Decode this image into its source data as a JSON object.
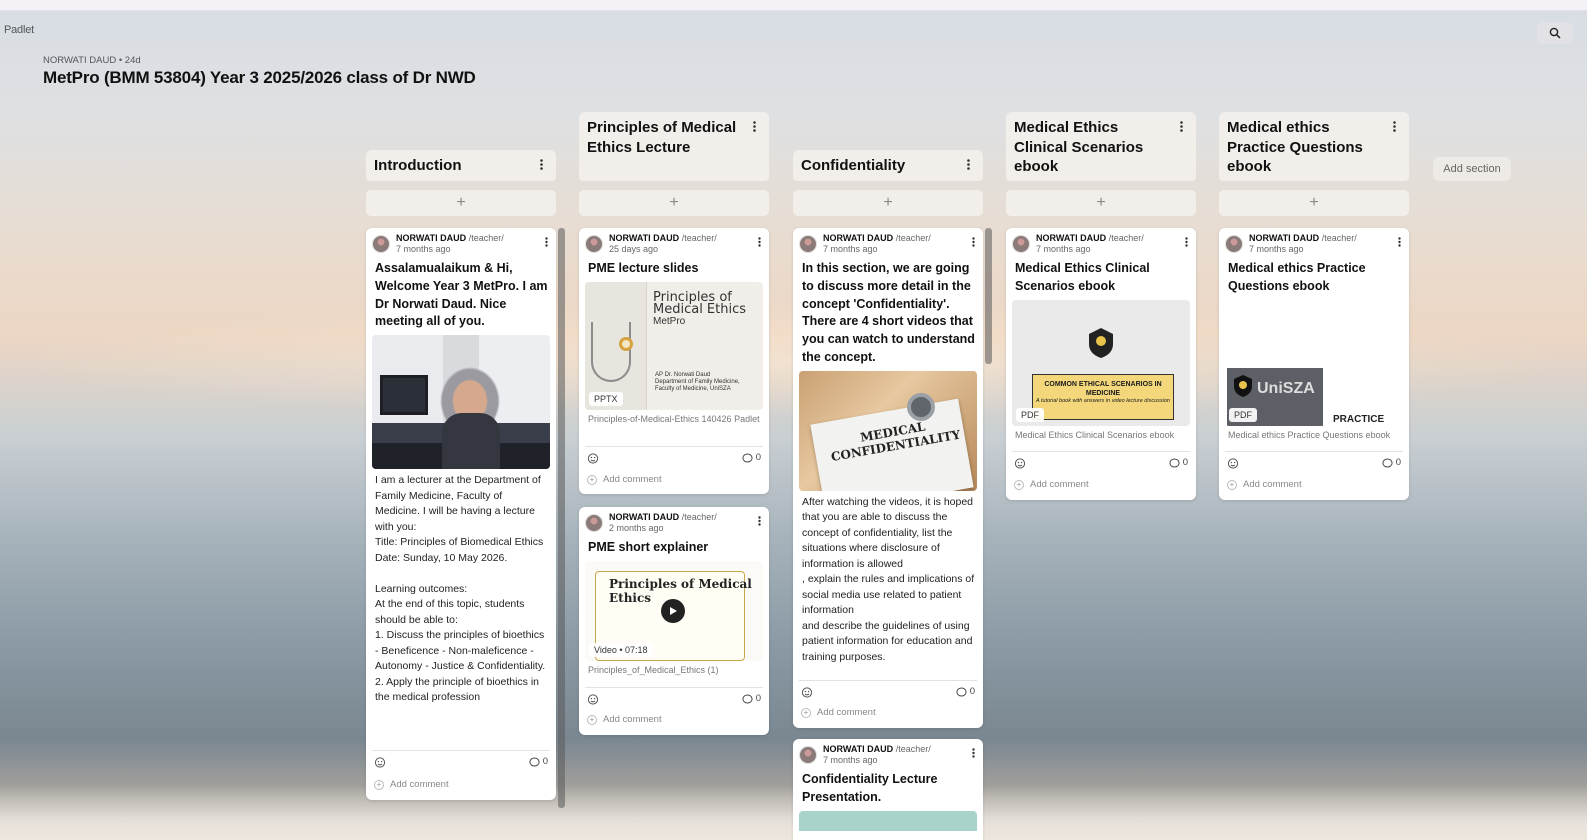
{
  "app": {
    "brand": "Padlet"
  },
  "board": {
    "meta": "NORWATI DAUD • 24d",
    "title": "MetPro  (BMM 53804) Year 3 2025/2026 class of Dr NWD",
    "add_section_label": "Add section"
  },
  "common": {
    "author": "NORWATI DAUD",
    "role": "/teacher/",
    "add_comment": "Add comment",
    "add_post_symbol": "+"
  },
  "sections": [
    {
      "title": "Introduction",
      "posts": [
        {
          "ago": "7 months ago",
          "title": "Assalamualaikum & Hi, Welcome Year 3 MetPro. I am Dr Norwati Daud. Nice meeting all of you.",
          "body": "I am a lecturer at the Department of Family Medicine, Faculty of Medicine. I will be having a lecture with you:\nTitle: Principles of Biomedical Ethics\nDate: Sunday, 10 May 2026.\n\nLearning outcomes:\nAt the end of this topic, students should be able to:\n1. Discuss the principles of bioethics - Beneficence - Non-maleficence - Autonomy - Justice & Confidentiality.\n2. Apply the principle of bioethics in the medical profession",
          "comments": "0"
        }
      ]
    },
    {
      "title": "Principles of Medical Ethics Lecture",
      "posts": [
        {
          "ago": "25 days ago",
          "title": "PME lecture slides",
          "attachment": {
            "type": "PPTX",
            "slide_title": "Principles of Medical Ethics",
            "slide_sub": "MetPro",
            "slide_credit": "AP Dr. Norwati Daud\nDepartment of Family Medicine,\nFaculty of Medicine, UniSZA",
            "caption": "Principles-of-Medical-Ethics 140426 Padlet"
          },
          "comments": "0"
        },
        {
          "ago": "2 months ago",
          "title": "PME short explainer",
          "attachment": {
            "type": "Video • 07:18",
            "video_title": "Principles of Medical Ethics",
            "caption": "Principles_of_Medical_Ethics (1)"
          },
          "comments": "0"
        }
      ]
    },
    {
      "title": "Confidentiality",
      "posts": [
        {
          "ago": "7 months ago",
          "title": "In this section, we are going to discuss more detail in the concept  'Confidentiality'. There are 4 short videos that you can watch to understand the concept.",
          "image_text": "MEDICAL CONFIDENTIALITY",
          "body": "After watching the videos, it is hoped that you are able to discuss the concept of confidentiality, list the situations where disclosure of information is allowed\n, explain the rules and implications of social media use related to patient information\nand describe the guidelines of using patient information for education and training purposes.",
          "comments": "0"
        },
        {
          "ago": "7 months ago",
          "title": "Confidentiality Lecture Presentation."
        }
      ]
    },
    {
      "title": "Medical Ethics Clinical Scenarios ebook",
      "posts": [
        {
          "ago": "7 months ago",
          "title": " Medical Ethics Clinical Scenarios ebook",
          "attachment": {
            "type": "PDF",
            "cover_logo": "UniSZA",
            "cover_title": "COMMON ETHICAL SCENARIOS IN MEDICINE",
            "cover_sub": "A tutorial book with answers in video lecture discussion",
            "caption": "Medical Ethics Clinical Scenarios ebook"
          },
          "comments": "0"
        }
      ]
    },
    {
      "title": "Medical ethics Practice Questions ebook",
      "posts": [
        {
          "ago": "7 months ago",
          "title": "Medical ethics Practice Questions ebook",
          "attachment": {
            "type": "PDF",
            "cover_logo": "UniSZA",
            "cover_word": "PRACTICE",
            "caption": "Medical ethics Practice Questions ebook"
          },
          "comments": "0"
        }
      ]
    }
  ],
  "colors": {
    "card": "#ffffff",
    "header_bg": "#f4f0ec",
    "text": "#111111",
    "muted": "#666666"
  }
}
